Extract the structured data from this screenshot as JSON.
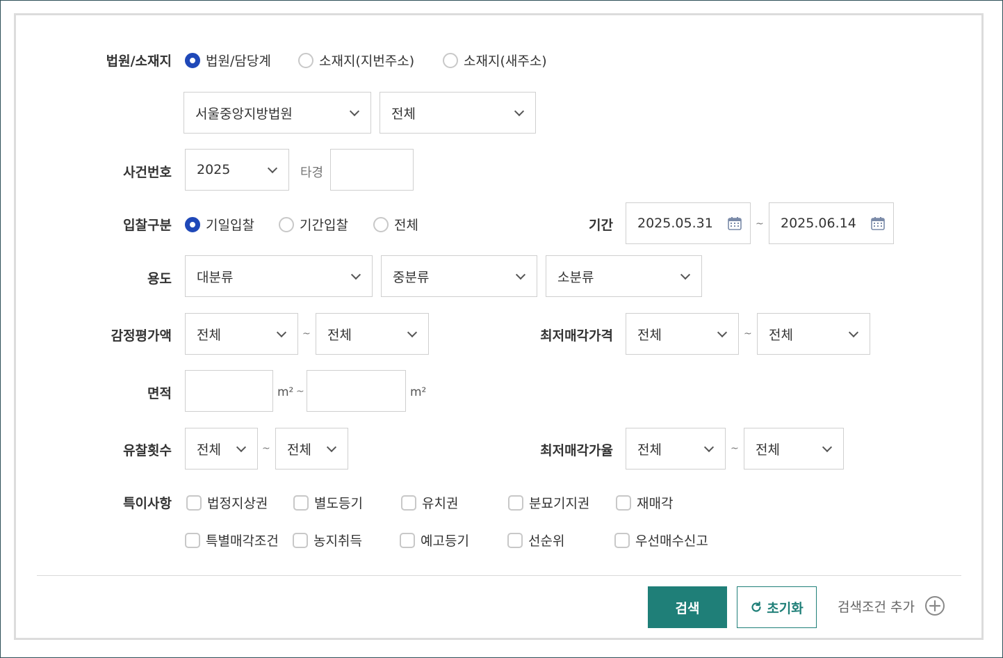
{
  "court": {
    "label": "법원/소재지",
    "options": [
      "법원/담당계",
      "소재지(지번주소)",
      "소재지(새주소)"
    ],
    "court_select": "서울중앙지방법원",
    "dept_select": "전체"
  },
  "case": {
    "label": "사건번호",
    "year": "2025",
    "type_label": "타경",
    "number_value": ""
  },
  "bid": {
    "label": "입찰구분",
    "options": [
      "기일입찰",
      "기간입찰",
      "전체"
    ],
    "period_label": "기간",
    "date_from": "2025.05.31",
    "date_to": "2025.06.14",
    "tilde": "~"
  },
  "usage": {
    "label": "용도",
    "major": "대분류",
    "middle": "중분류",
    "minor": "소분류"
  },
  "appraisal": {
    "label": "감정평가액",
    "from": "전체",
    "to": "전체",
    "tilde": "~"
  },
  "min_price": {
    "label": "최저매각가격",
    "from": "전체",
    "to": "전체",
    "tilde": "~"
  },
  "area": {
    "label": "면적",
    "from_value": "",
    "to_value": "",
    "unit": "m²",
    "tilde": "~"
  },
  "fail_count": {
    "label": "유찰횟수",
    "from": "전체",
    "to": "전체",
    "tilde": "~"
  },
  "min_rate": {
    "label": "최저매각가율",
    "from": "전체",
    "to": "전체",
    "tilde": "~"
  },
  "special": {
    "label": "특이사항",
    "row1": [
      "법정지상권",
      "별도등기",
      "유치권",
      "분묘기지권",
      "재매각"
    ],
    "row2": [
      "특별매각조건",
      "농지취득",
      "예고등기",
      "선순위",
      "우선매수신고"
    ]
  },
  "actions": {
    "search": "검색",
    "reset": "초기화",
    "add_condition": "검색조건 추가"
  },
  "colors": {
    "accent": "#1f7f78",
    "radio_on": "#1f48b8"
  }
}
